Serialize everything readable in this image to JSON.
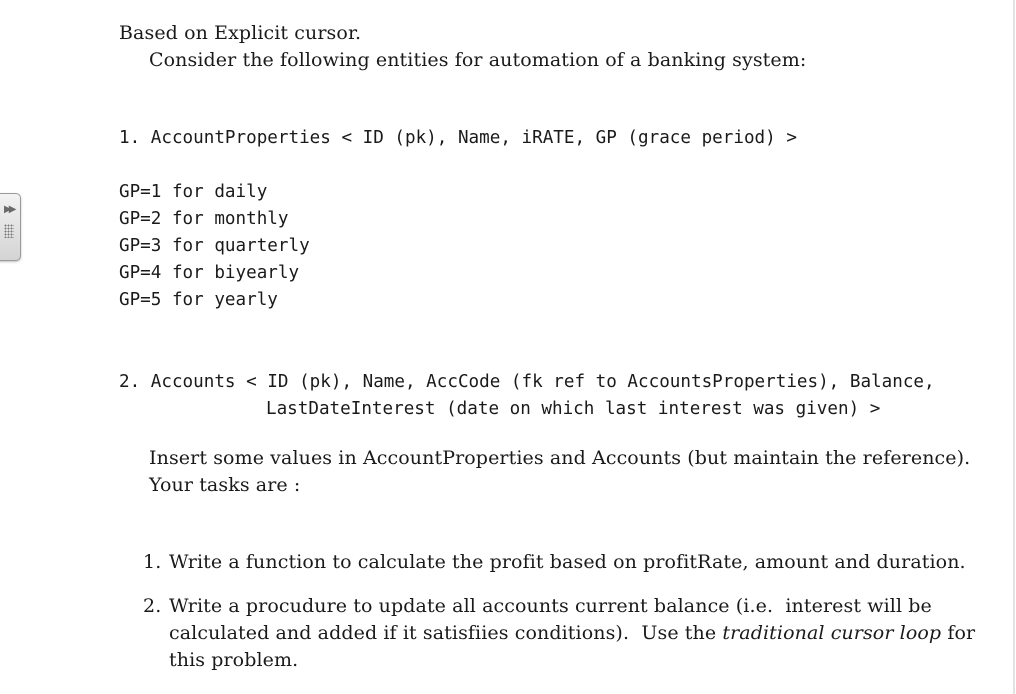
{
  "header": {
    "line1": "Based on Explicit cursor.",
    "line2": "Consider the following entities for automation of a banking system:"
  },
  "entity1": {
    "line": "1. AccountProperties < ID (pk), Name, iRATE, GP (grace period) >",
    "gp_lines": [
      "GP=1 for daily",
      "GP=2 for monthly",
      "GP=3 for quarterly",
      "GP=4 for biyearly",
      "GP=5 for yearly"
    ]
  },
  "entity2": {
    "line1": "2. Accounts < ID (pk), Name, AccCode (fk ref to AccountsProperties), Balance,",
    "line2": "LastDateInterest (date on which last interest was given) >"
  },
  "instructions": {
    "line1": "Insert some values in AccountProperties and Accounts (but maintain the reference).",
    "line2": "Your tasks are :"
  },
  "tasks": [
    {
      "number": "1.",
      "lines": [
        "Write a function to calculate the profit based on profitRate, amount and duration."
      ]
    },
    {
      "number": "2.",
      "line1": "Write a procudure to update all accounts current balance (i.e.  interest will be",
      "line2_pre": "calculated and added if it satisfiies conditions).  Use the ",
      "line2_italic": "traditional cursor loop",
      "line2_post": " for",
      "line3": "this problem."
    }
  ]
}
